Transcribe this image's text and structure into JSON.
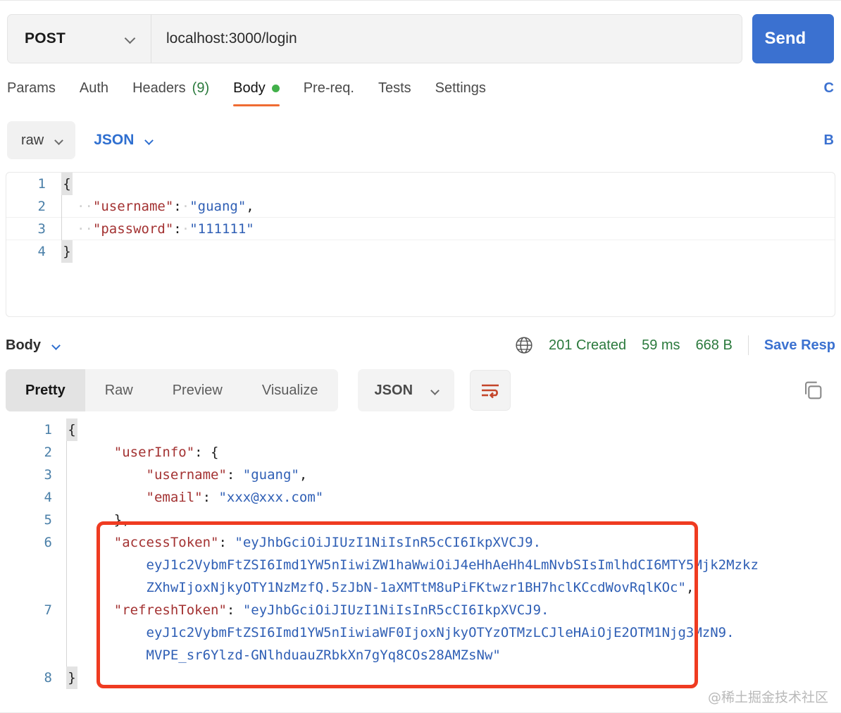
{
  "request": {
    "method": "POST",
    "url": "localhost:3000/login",
    "send_label": "Send",
    "tabs": [
      {
        "label": "Params",
        "active": false,
        "badge": "",
        "dot": false
      },
      {
        "label": "Auth",
        "active": false,
        "badge": "",
        "dot": false
      },
      {
        "label": "Headers",
        "active": false,
        "badge": "(9)",
        "dot": false
      },
      {
        "label": "Body",
        "active": true,
        "badge": "",
        "dot": true
      },
      {
        "label": "Pre-req.",
        "active": false,
        "badge": "",
        "dot": false
      },
      {
        "label": "Tests",
        "active": false,
        "badge": "",
        "dot": false
      },
      {
        "label": "Settings",
        "active": false,
        "badge": "",
        "dot": false
      }
    ],
    "cookies_link": "C",
    "body_mode": "raw",
    "body_format": "JSON",
    "beautify_link": "B",
    "body_lines": [
      {
        "n": "1",
        "fold": "{",
        "indent": false,
        "segments": []
      },
      {
        "n": "2",
        "fold": "",
        "indent": true,
        "segments": [
          {
            "t": "··",
            "c": "ws"
          },
          {
            "t": "\"username\"",
            "c": "k"
          },
          {
            "t": ":",
            "c": "p"
          },
          {
            "t": "·",
            "c": "ws"
          },
          {
            "t": "\"guang\"",
            "c": "s"
          },
          {
            "t": ",",
            "c": "p"
          }
        ]
      },
      {
        "n": "3",
        "fold": "",
        "indent": true,
        "segments": [
          {
            "t": "··",
            "c": "ws"
          },
          {
            "t": "\"password\"",
            "c": "k"
          },
          {
            "t": ":",
            "c": "p"
          },
          {
            "t": "·",
            "c": "ws"
          },
          {
            "t": "\"111111\"",
            "c": "s"
          }
        ]
      },
      {
        "n": "4",
        "fold": "}",
        "indent": false,
        "segments": []
      }
    ]
  },
  "response": {
    "body_dropdown": "Body",
    "status_icon": "globe-icon",
    "status_text": "201 Created",
    "time": "59 ms",
    "size": "668 B",
    "save_response": "Save Resp",
    "view_tabs": [
      {
        "label": "Pretty",
        "active": true
      },
      {
        "label": "Raw",
        "active": false
      },
      {
        "label": "Preview",
        "active": false
      },
      {
        "label": "Visualize",
        "active": false
      }
    ],
    "format": "JSON",
    "wrap_icon": "word-wrap-icon",
    "copy_icon": "copy-icon",
    "lines": [
      {
        "n": "1",
        "fold": "{",
        "indent": false,
        "rows": [
          []
        ]
      },
      {
        "n": "2",
        "fold": "",
        "indent": true,
        "rows": [
          [
            {
              "t": "    ",
              "c": "p"
            },
            {
              "t": "\"userInfo\"",
              "c": "k"
            },
            {
              "t": ": {",
              "c": "p"
            }
          ]
        ]
      },
      {
        "n": "3",
        "fold": "",
        "indent": true,
        "rows": [
          [
            {
              "t": "        ",
              "c": "p"
            },
            {
              "t": "\"username\"",
              "c": "k"
            },
            {
              "t": ": ",
              "c": "p"
            },
            {
              "t": "\"guang\"",
              "c": "s"
            },
            {
              "t": ",",
              "c": "p"
            }
          ]
        ]
      },
      {
        "n": "4",
        "fold": "",
        "indent": true,
        "rows": [
          [
            {
              "t": "        ",
              "c": "p"
            },
            {
              "t": "\"email\"",
              "c": "k"
            },
            {
              "t": ": ",
              "c": "p"
            },
            {
              "t": "\"xxx@xxx.com\"",
              "c": "s"
            }
          ]
        ]
      },
      {
        "n": "5",
        "fold": "",
        "indent": true,
        "rows": [
          [
            {
              "t": "    },",
              "c": "p"
            }
          ]
        ]
      },
      {
        "n": "6",
        "fold": "",
        "indent": true,
        "rows": [
          [
            {
              "t": "    ",
              "c": "p"
            },
            {
              "t": "\"accessToken\"",
              "c": "k"
            },
            {
              "t": ": ",
              "c": "p"
            },
            {
              "t": "\"eyJhbGciOiJIUzI1NiIsInR5cCI6IkpXVCJ9.",
              "c": "s"
            }
          ],
          [
            {
              "t": "        ",
              "c": "p"
            },
            {
              "t": "eyJ1c2VybmFtZSI6Imd1YW5nIiwiZW1haWwiOiJ4eHhAeHh4LmNvbSIsImlhdCI6MTY5Mjk2Mzkz",
              "c": "s"
            }
          ],
          [
            {
              "t": "        ",
              "c": "p"
            },
            {
              "t": "ZXhwIjoxNjkyOTY1NzMzfQ.5zJbN-1aXMTtM8uPiFKtwzr1BH7hclKCcdWovRqlKOc\"",
              "c": "s"
            },
            {
              "t": ",",
              "c": "p"
            }
          ]
        ]
      },
      {
        "n": "7",
        "fold": "",
        "indent": true,
        "rows": [
          [
            {
              "t": "    ",
              "c": "p"
            },
            {
              "t": "\"refreshToken\"",
              "c": "k"
            },
            {
              "t": ": ",
              "c": "p"
            },
            {
              "t": "\"eyJhbGciOiJIUzI1NiIsInR5cCI6IkpXVCJ9.",
              "c": "s"
            }
          ],
          [
            {
              "t": "        ",
              "c": "p"
            },
            {
              "t": "eyJ1c2VybmFtZSI6Imd1YW5nIiwiaWF0IjoxNjkyOTYzOTMzLCJleHAiOjE2OTM1Njg3MzN9.",
              "c": "s"
            }
          ],
          [
            {
              "t": "        ",
              "c": "p"
            },
            {
              "t": "MVPE_sr6Ylzd-GNlhduauZRbkXn7gYq8COs28AMZsNw\"",
              "c": "s"
            }
          ]
        ]
      },
      {
        "n": "8",
        "fold": "}",
        "indent": false,
        "rows": [
          []
        ]
      }
    ]
  },
  "annotation": {
    "highlight_color": "#ef3b21",
    "label": "accessToken-and-refreshToken-highlight"
  },
  "watermark": "@稀土掘金技术社区"
}
